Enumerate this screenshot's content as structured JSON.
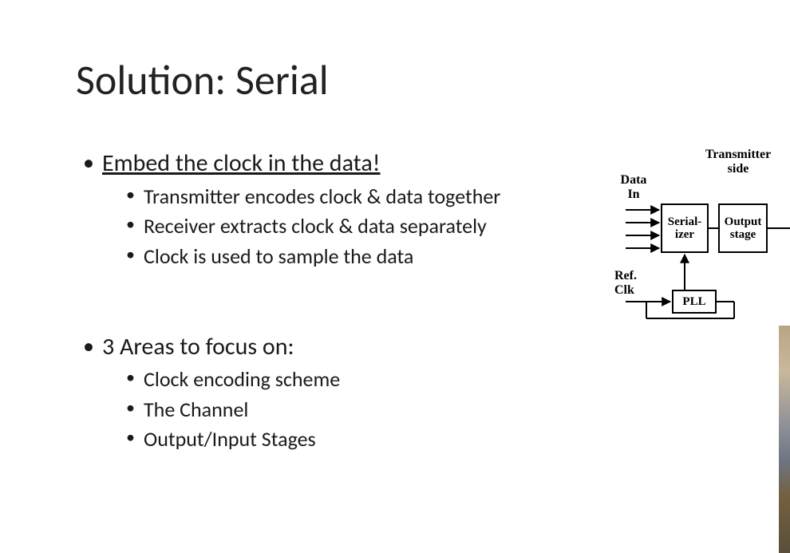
{
  "title": "Solution: Serial",
  "bullets": {
    "main1": "Embed the clock in the data!",
    "sub1a": "Transmitter encodes clock & data together",
    "sub1b": "Receiver extracts clock & data separately",
    "sub1c": "Clock is used to sample the data",
    "main2": "3 Areas to focus on:",
    "sub2a": "Clock encoding scheme",
    "sub2b": "The Channel",
    "sub2c": "Output/Input Stages"
  },
  "diagram": {
    "heading": "Transmitter side",
    "data_in": "Data In",
    "ref_clk": "Ref. Clk",
    "serializer": "Serial- izer",
    "output_stage": "Output stage",
    "pll": "PLL"
  }
}
